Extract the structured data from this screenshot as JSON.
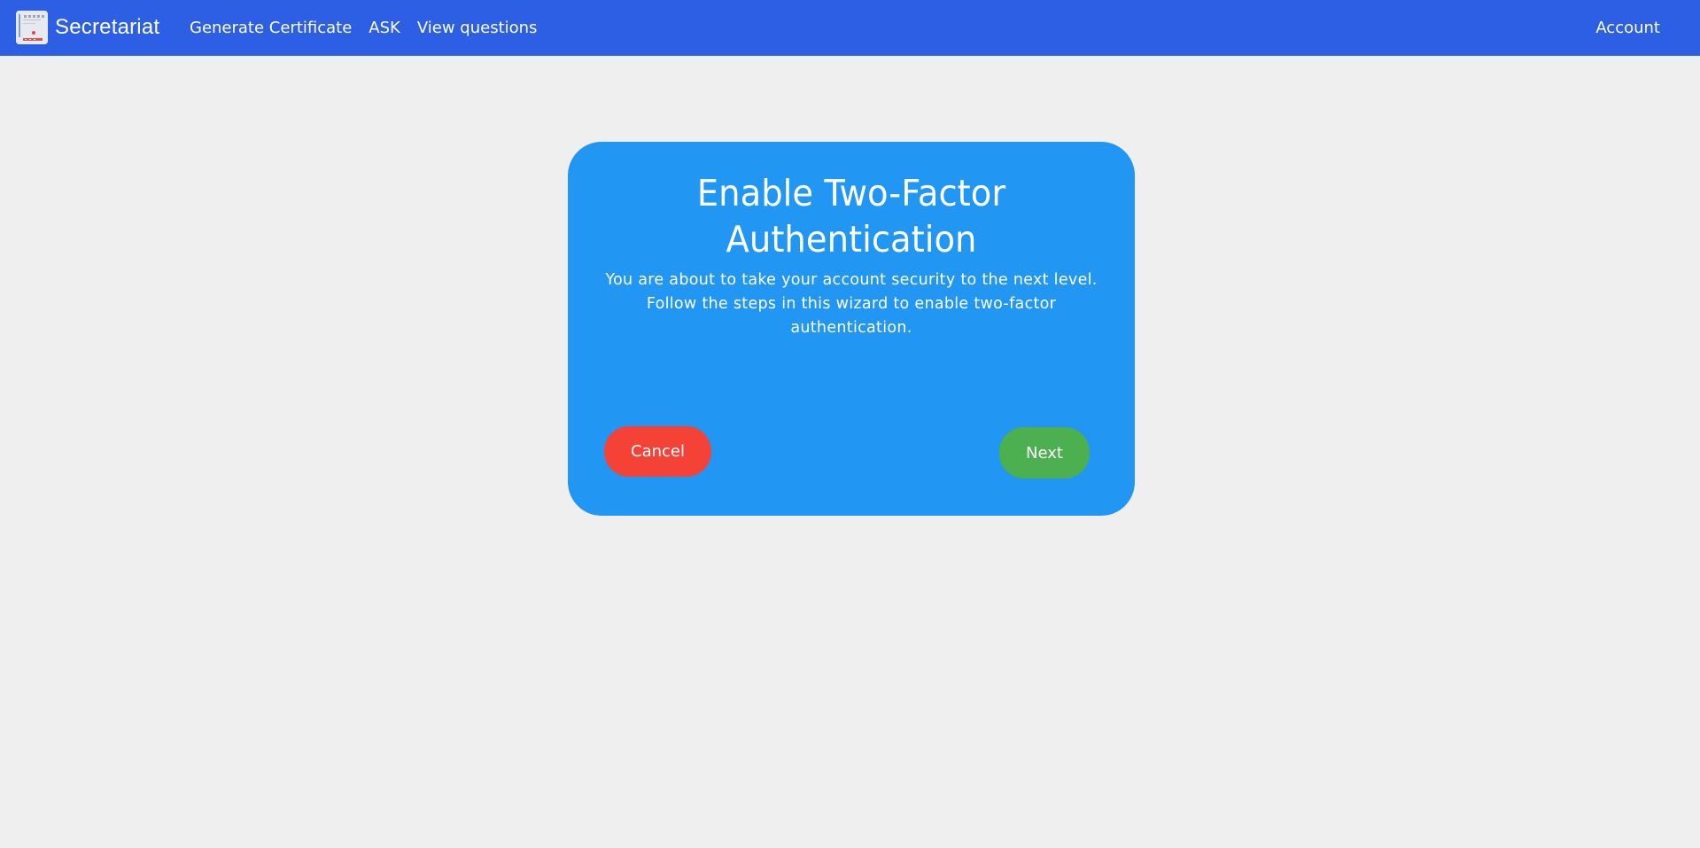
{
  "navbar": {
    "brand_name": "Secretariat",
    "logo_icon": "certificate-document-icon",
    "links": [
      "Generate Certificate",
      "ASK",
      "View questions"
    ],
    "account_label": "Account",
    "color": "#2c5fe3"
  },
  "dialog": {
    "title": "Enable Two-Factor Authentication",
    "description": "You are about to take your account security to the next level. Follow the steps in this wizard to enable two-factor authentication.",
    "cancel_label": "Cancel",
    "next_label": "Next",
    "color": "#2196f3",
    "cancel_color": "#f44336",
    "next_color": "#4caf50"
  },
  "page": {
    "background": "#efefef"
  }
}
